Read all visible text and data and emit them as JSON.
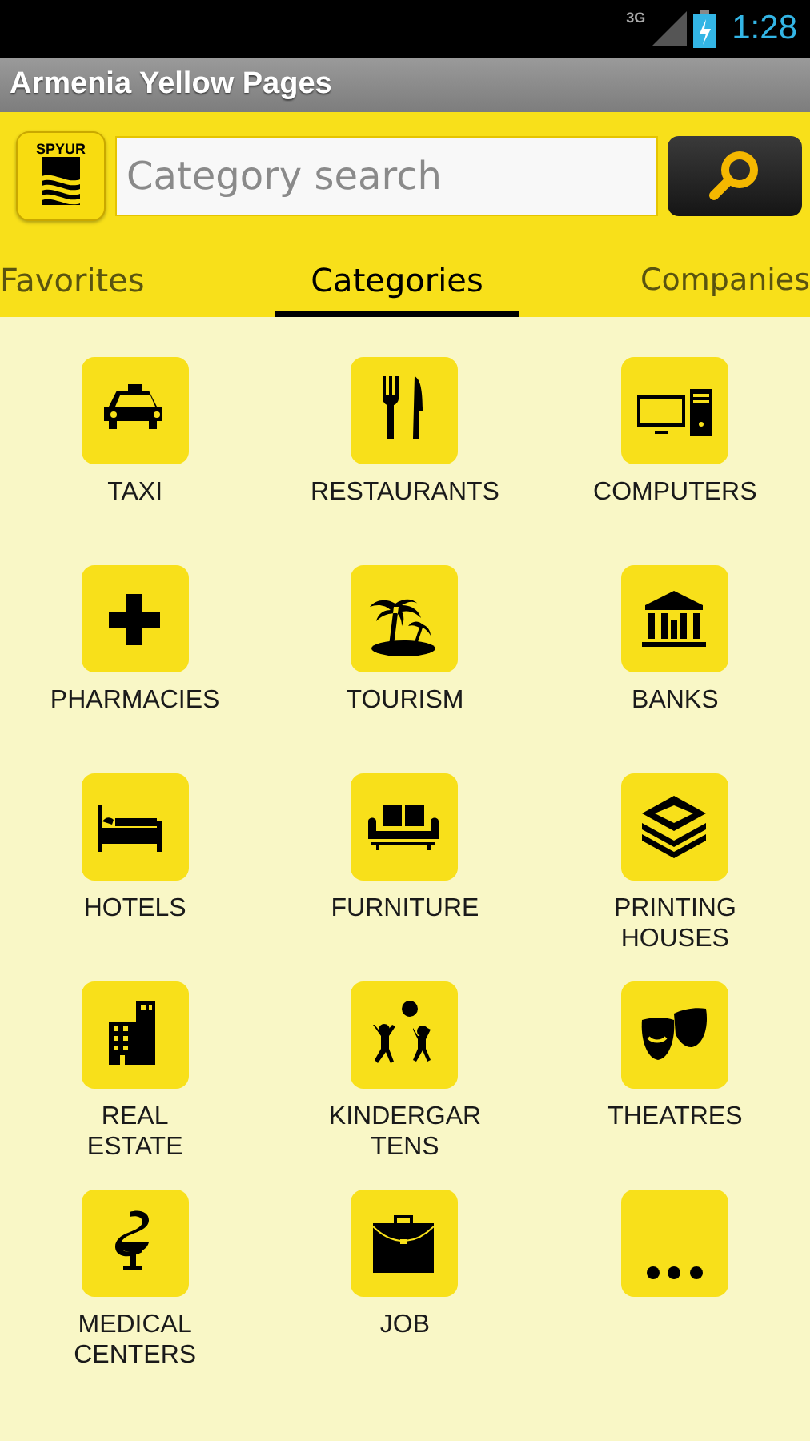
{
  "status_bar": {
    "network": "3G",
    "time": "1:28"
  },
  "window": {
    "title": "Armenia Yellow Pages"
  },
  "logo": {
    "text": "SPYUR"
  },
  "search": {
    "placeholder": "Category search"
  },
  "tabs": [
    {
      "label": "Favorites",
      "selected": false
    },
    {
      "label": "Categories",
      "selected": true
    },
    {
      "label": "Companies",
      "selected": false
    }
  ],
  "categories": [
    {
      "label": "TAXI"
    },
    {
      "label": "RESTAURANTS"
    },
    {
      "label": "COMPUTERS"
    },
    {
      "label": "PHARMACIES"
    },
    {
      "label": "TOURISM"
    },
    {
      "label": "BANKS"
    },
    {
      "label": "HOTELS"
    },
    {
      "label": "FURNITURE"
    },
    {
      "label": "PRINTING\nHOUSES"
    },
    {
      "label": "REAL\nESTATE"
    },
    {
      "label": "KINDERGAR\nTENS"
    },
    {
      "label": "THEATRES"
    },
    {
      "label": "MEDICAL\nCENTERS"
    },
    {
      "label": "JOB"
    }
  ]
}
